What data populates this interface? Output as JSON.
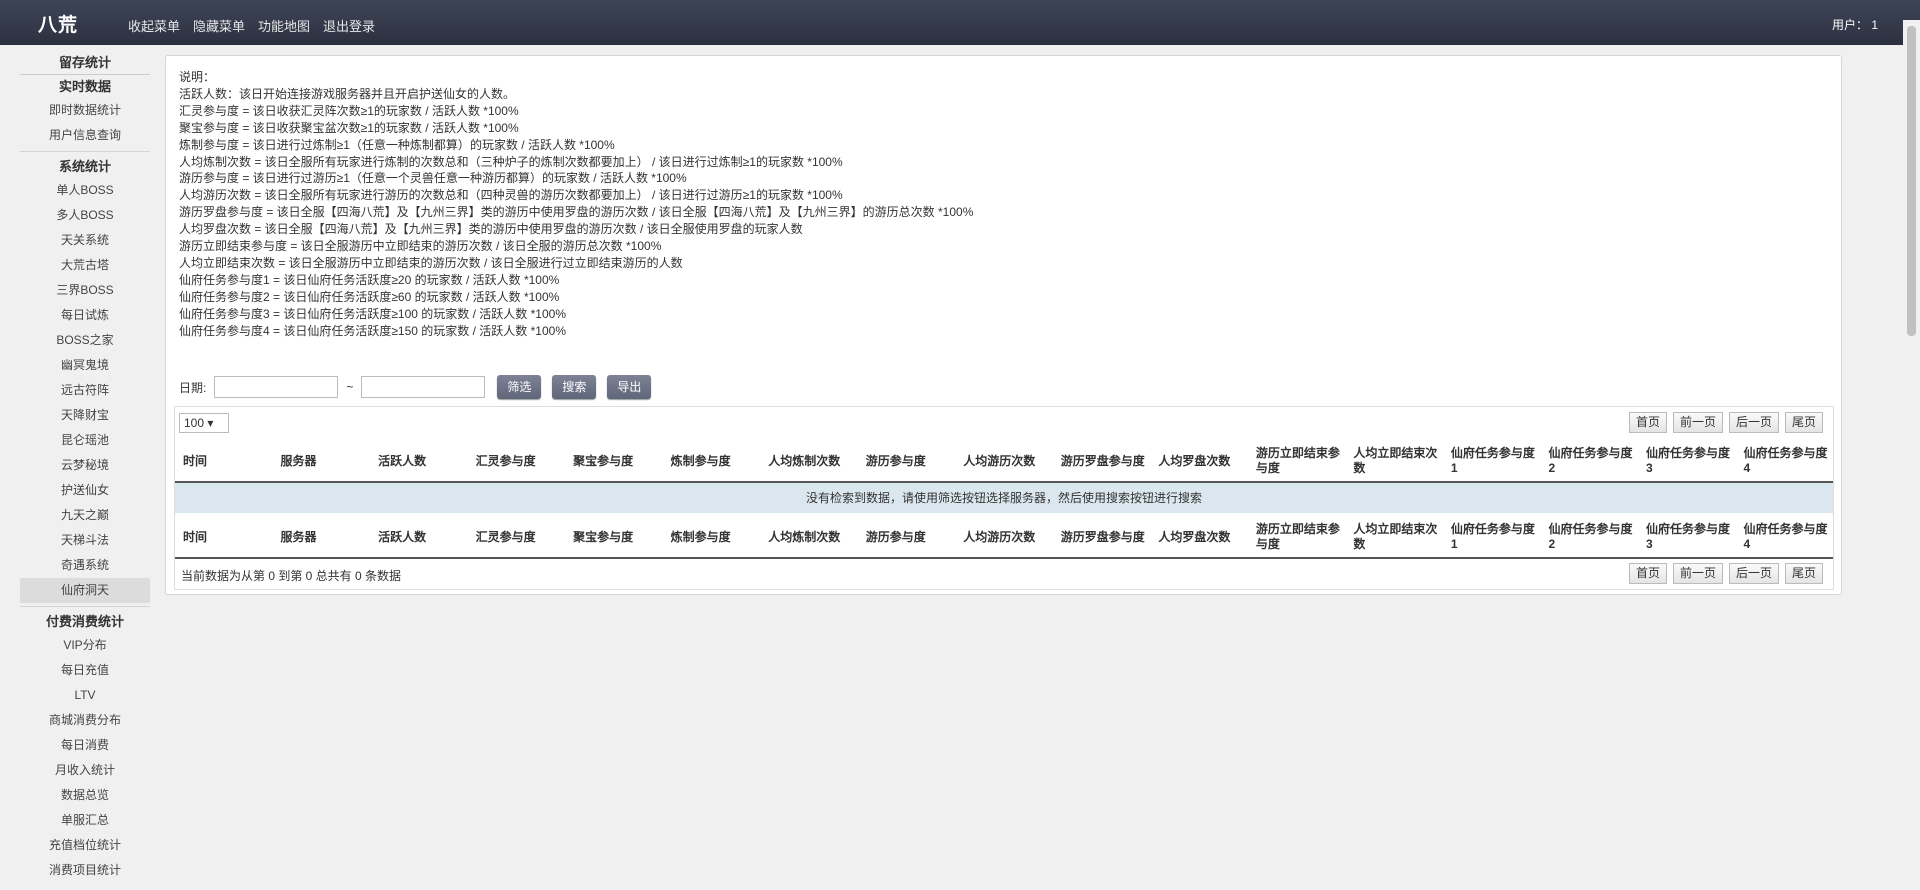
{
  "topbar": {
    "brand": "八荒",
    "nav": [
      "收起菜单",
      "隐藏菜单",
      "功能地图",
      "退出登录"
    ],
    "user": "用户： 1"
  },
  "sidebar": {
    "top_heading": "留存统计",
    "groups": [
      {
        "heading": "实时数据",
        "items": [
          "即时数据统计",
          "用户信息查询"
        ]
      },
      {
        "heading": "系统统计",
        "items": [
          "单人BOSS",
          "多人BOSS",
          "天关系统",
          "大荒古塔",
          "三界BOSS",
          "每日试炼",
          "BOSS之家",
          "幽冥鬼境",
          "远古符阵",
          "天降财宝",
          "昆仑瑶池",
          "云梦秘境",
          "护送仙女",
          "九天之巅",
          "天梯斗法",
          "奇遇系统",
          "仙府洞天"
        ]
      },
      {
        "heading": "付费消费统计",
        "items": [
          "VIP分布",
          "每日充值",
          "LTV",
          "商城消费分布",
          "每日消费",
          "月收入统计",
          "数据总览",
          "单服汇总",
          "充值档位统计",
          "消费项目统计"
        ]
      }
    ],
    "active": "仙府洞天"
  },
  "description": [
    "说明：",
    "活跃人数：该日开始连接游戏服务器并且开启护送仙女的人数。",
    "汇灵参与度 = 该日收获汇灵阵次数≥1的玩家数 / 活跃人数 *100%",
    "聚宝参与度 = 该日收获聚宝盆次数≥1的玩家数 / 活跃人数 *100%",
    "炼制参与度 = 该日进行过炼制≥1（任意一种炼制都算）的玩家数 / 活跃人数 *100%",
    "人均炼制次数 = 该日全服所有玩家进行炼制的次数总和（三种炉子的炼制次数都要加上） / 该日进行过炼制≥1的玩家数 *100%",
    "游历参与度 = 该日进行过游历≥1（任意一个灵兽任意一种游历都算）的玩家数 / 活跃人数 *100%",
    "人均游历次数 = 该日全服所有玩家进行游历的次数总和（四种灵兽的游历次数都要加上） / 该日进行过游历≥1的玩家数 *100%",
    "游历罗盘参与度 = 该日全服【四海八荒】及【九州三界】类的游历中使用罗盘的游历次数 / 该日全服【四海八荒】及【九州三界】的游历总次数 *100%",
    "人均罗盘次数 = 该日全服【四海八荒】及【九州三界】类的游历中使用罗盘的游历次数 / 该日全服使用罗盘的玩家人数",
    "游历立即结束参与度 = 该日全服游历中立即结束的游历次数 / 该日全服的游历总次数 *100%",
    "人均立即结束次数 = 该日全服游历中立即结束的游历次数 / 该日全服进行过立即结束游历的人数",
    "仙府任务参与度1 = 该日仙府任务活跃度≥20 的玩家数 / 活跃人数 *100%",
    "仙府任务参与度2 = 该日仙府任务活跃度≥60 的玩家数 / 活跃人数 *100%",
    "仙府任务参与度3 = 该日仙府任务活跃度≥100 的玩家数 / 活跃人数 *100%",
    "仙府任务参与度4 = 该日仙府任务活跃度≥150 的玩家数 / 活跃人数 *100%"
  ],
  "filter": {
    "date_label": "日期:",
    "start_value": "",
    "end_value": "",
    "separator": "~",
    "buttons": {
      "filter": "筛选",
      "search": "搜索",
      "export": "导出"
    }
  },
  "table": {
    "page_size": "100 ▾",
    "pager": [
      "首页",
      "前一页",
      "后一页",
      "尾页"
    ],
    "columns": [
      "时间",
      "服务器",
      "活跃人数",
      "汇灵参与度",
      "聚宝参与度",
      "炼制参与度",
      "人均炼制次数",
      "游历参与度",
      "人均游历次数",
      "游历罗盘参与度",
      "人均罗盘次数",
      "游历立即结束参与度",
      "人均立即结束次数",
      "仙府任务参与度1",
      "仙府任务参与度2",
      "仙府任务参与度3",
      "仙府任务参与度4"
    ],
    "empty_message": "没有检索到数据，请使用筛选按钮选择服务器，然后使用搜索按钮进行搜索",
    "info": "当前数据为从第 0 到第 0 总共有 0 条数据"
  }
}
